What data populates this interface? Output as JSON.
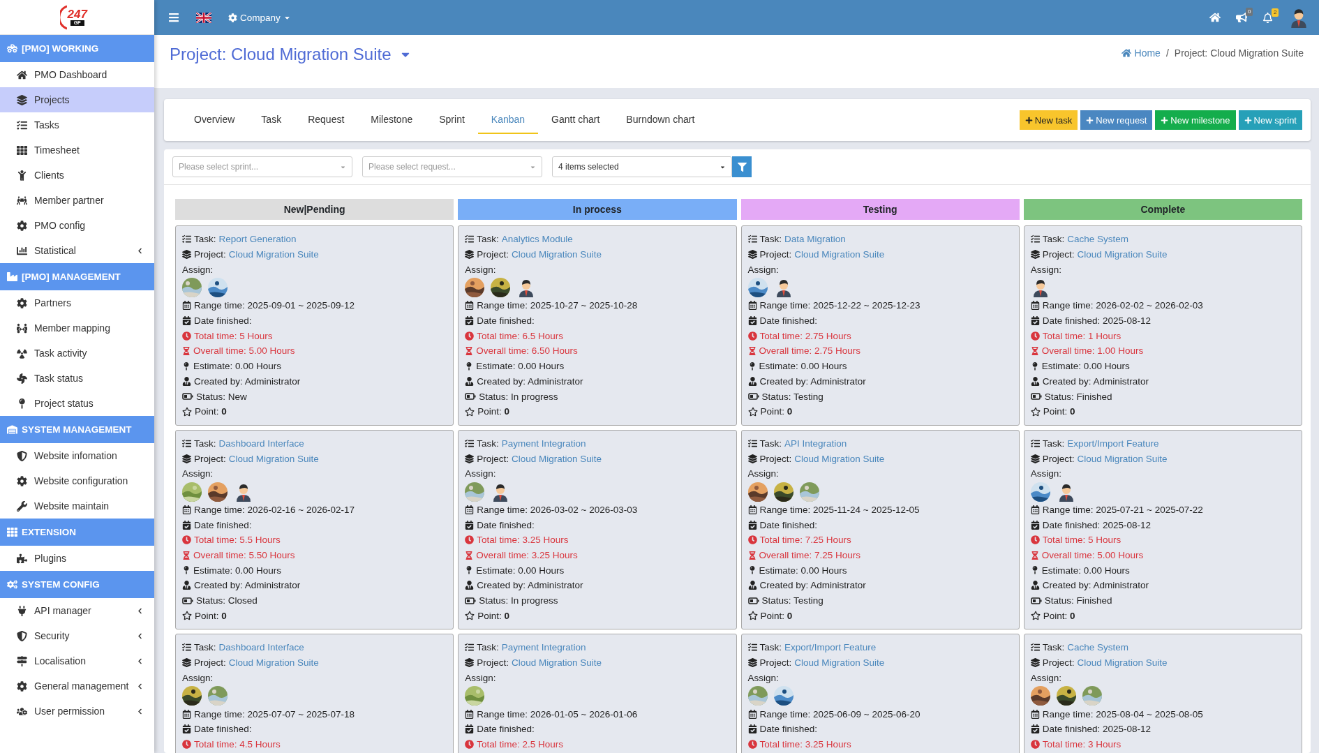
{
  "logo": {
    "text": "247",
    "sub": "GP"
  },
  "sidebar": {
    "sections": [
      {
        "title": "[PMO] WORKING",
        "items": [
          {
            "label": "PMO Dashboard",
            "selected": false
          },
          {
            "label": "Projects",
            "selected": true
          },
          {
            "label": "Tasks",
            "selected": false
          },
          {
            "label": "Timesheet",
            "selected": false
          },
          {
            "label": "Clients",
            "selected": false
          },
          {
            "label": "Member partner",
            "selected": false
          },
          {
            "label": "PMO config",
            "selected": false
          },
          {
            "label": "Statistical",
            "selected": false,
            "expanded": false
          }
        ]
      },
      {
        "title": "[PMO] MANAGEMENT",
        "items": [
          {
            "label": "Partners",
            "selected": false
          },
          {
            "label": "Member mapping",
            "selected": false
          },
          {
            "label": "Task activity",
            "selected": false
          },
          {
            "label": "Task status",
            "selected": false
          },
          {
            "label": "Project status",
            "selected": false
          }
        ]
      },
      {
        "title": "SYSTEM MANAGEMENT",
        "items": [
          {
            "label": "Website infomation",
            "selected": false
          },
          {
            "label": "Website configuration",
            "selected": false
          },
          {
            "label": "Website maintain",
            "selected": false
          }
        ]
      },
      {
        "title": "EXTENSION",
        "items": [
          {
            "label": "Plugins",
            "selected": false
          }
        ]
      },
      {
        "title": "SYSTEM CONFIG",
        "items": [
          {
            "label": "API manager",
            "selected": false,
            "expanded": false
          },
          {
            "label": "Security",
            "selected": false,
            "expanded": false
          },
          {
            "label": "Localisation",
            "selected": false,
            "expanded": false
          },
          {
            "label": "General management",
            "selected": false,
            "expanded": false
          },
          {
            "label": "User permission",
            "selected": false,
            "expanded": false
          }
        ]
      }
    ]
  },
  "topbar": {
    "menu": "Company",
    "announcements": "0",
    "notifications": "2"
  },
  "page_title": "Project: Cloud Migration Suite",
  "breadcrumb": {
    "home": "Home",
    "separator": "/",
    "current": "Project: Cloud Migration Suite"
  },
  "tabs": [
    {
      "label": "Overview",
      "selected": false
    },
    {
      "label": "Task",
      "selected": false
    },
    {
      "label": "Request",
      "selected": false
    },
    {
      "label": "Milestone",
      "selected": false
    },
    {
      "label": "Sprint",
      "selected": false
    },
    {
      "label": "Kanban",
      "selected": true
    },
    {
      "label": "Gantt chart",
      "selected": false
    },
    {
      "label": "Burndown chart",
      "selected": false
    }
  ],
  "actions": [
    {
      "label": "New task",
      "color": "#f8c52c"
    },
    {
      "label": "New request",
      "color": "#4a87c1"
    },
    {
      "label": "New milestone",
      "color": "#14ad4c"
    },
    {
      "label": "New sprint",
      "color": "#26a0b8"
    }
  ],
  "filters": [
    {
      "placeholder": "Please select sprint..."
    },
    {
      "placeholder": "Please select request..."
    },
    {
      "value": "4 items selected"
    }
  ],
  "columns": [
    {
      "title": "New|Pending",
      "color": "#dddddd",
      "cards": [
        {
          "task_label": "Task:",
          "task": "Report Generation",
          "project_label": "Project:",
          "project": "Cloud Migration Suite",
          "assign_label": "Assign:",
          "assign": [
            {
              "kind": "picture"
            },
            {
              "kind": "picture"
            }
          ],
          "range": "Range time: 2025-09-01 ~ 2025-09-12",
          "finished": "Date finished:",
          "total": "Total time: 5 Hours",
          "overall": "Overall time: 5.00 Hours",
          "estimate": "Estimate: 0.00 Hours",
          "created": "Created by: Administrator",
          "status": "Status: New",
          "point_label": "Point:",
          "point": "0"
        },
        {
          "task_label": "Task:",
          "task": "Dashboard Interface",
          "project_label": "Project:",
          "project": "Cloud Migration Suite",
          "assign_label": "Assign:",
          "assign": [
            {
              "kind": "picture"
            },
            {
              "kind": "picture"
            },
            {
              "kind": "person"
            }
          ],
          "range": "Range time: 2026-02-16 ~ 2026-02-17",
          "finished": "Date finished:",
          "total": "Total time: 5.5 Hours",
          "overall": "Overall time: 5.50 Hours",
          "estimate": "Estimate: 0.00 Hours",
          "created": "Created by: Administrator",
          "status": "Status: Closed",
          "point_label": "Point:",
          "point": "0"
        },
        {
          "task_label": "Task:",
          "task": "Dashboard Interface",
          "project_label": "Project:",
          "project": "Cloud Migration Suite",
          "assign_label": "Assign:",
          "assign": [
            {
              "kind": "picture"
            },
            {
              "kind": "picture"
            }
          ],
          "range": "Range time: 2025-07-07 ~ 2025-07-18",
          "finished": "Date finished:",
          "total": "Total time: 4.5 Hours"
        }
      ]
    },
    {
      "title": "In process",
      "color": "#79aef7",
      "cards": [
        {
          "task_label": "Task:",
          "task": "Analytics Module",
          "project_label": "Project:",
          "project": "Cloud Migration Suite",
          "assign_label": "Assign:",
          "assign": [
            {
              "kind": "picture"
            },
            {
              "kind": "picture"
            },
            {
              "kind": "person"
            }
          ],
          "range": "Range time: 2025-10-27 ~ 2025-10-28",
          "finished": "Date finished:",
          "total": "Total time: 6.5 Hours",
          "overall": "Overall time: 6.50 Hours",
          "estimate": "Estimate: 0.00 Hours",
          "created": "Created by: Administrator",
          "status": "Status: In progress",
          "point_label": "Point:",
          "point": "0"
        },
        {
          "task_label": "Task:",
          "task": "Payment Integration",
          "project_label": "Project:",
          "project": "Cloud Migration Suite",
          "assign_label": "Assign:",
          "assign": [
            {
              "kind": "picture"
            },
            {
              "kind": "person"
            }
          ],
          "range": "Range time: 2026-03-02 ~ 2026-03-03",
          "finished": "Date finished:",
          "total": "Total time: 3.25 Hours",
          "overall": "Overall time: 3.25 Hours",
          "estimate": "Estimate: 0.00 Hours",
          "created": "Created by: Administrator",
          "status": "Status: In progress",
          "point_label": "Point:",
          "point": "0"
        },
        {
          "task_label": "Task:",
          "task": "Payment Integration",
          "project_label": "Project:",
          "project": "Cloud Migration Suite",
          "assign_label": "Assign:",
          "assign": [
            {
              "kind": "picture"
            }
          ],
          "range": "Range time: 2026-01-05 ~ 2026-01-06",
          "finished": "Date finished:",
          "total": "Total time: 2.5 Hours"
        }
      ]
    },
    {
      "title": "Testing",
      "color": "#e4a9f6",
      "cards": [
        {
          "task_label": "Task:",
          "task": "Data Migration",
          "project_label": "Project:",
          "project": "Cloud Migration Suite",
          "assign_label": "Assign:",
          "assign": [
            {
              "kind": "picture"
            },
            {
              "kind": "person"
            }
          ],
          "range": "Range time: 2025-12-22 ~ 2025-12-23",
          "finished": "Date finished:",
          "total": "Total time: 2.75 Hours",
          "overall": "Overall time: 2.75 Hours",
          "estimate": "Estimate: 0.00 Hours",
          "created": "Created by: Administrator",
          "status": "Status: Testing",
          "point_label": "Point:",
          "point": "0"
        },
        {
          "task_label": "Task:",
          "task": "API Integration",
          "project_label": "Project:",
          "project": "Cloud Migration Suite",
          "assign_label": "Assign:",
          "assign": [
            {
              "kind": "picture"
            },
            {
              "kind": "picture"
            },
            {
              "kind": "picture"
            }
          ],
          "range": "Range time: 2025-11-24 ~ 2025-12-05",
          "finished": "Date finished:",
          "total": "Total time: 7.25 Hours",
          "overall": "Overall time: 7.25 Hours",
          "estimate": "Estimate: 0.00 Hours",
          "created": "Created by: Administrator",
          "status": "Status: Testing",
          "point_label": "Point:",
          "point": "0"
        },
        {
          "task_label": "Task:",
          "task": "Export/Import Feature",
          "project_label": "Project:",
          "project": "Cloud Migration Suite",
          "assign_label": "Assign:",
          "assign": [
            {
              "kind": "picture"
            },
            {
              "kind": "picture"
            }
          ],
          "range": "Range time: 2025-06-09 ~ 2025-06-20",
          "finished": "Date finished:",
          "total": "Total time: 3.25 Hours"
        }
      ]
    },
    {
      "title": "Complete",
      "color": "#7dc47f",
      "cards": [
        {
          "task_label": "Task:",
          "task": "Cache System",
          "project_label": "Project:",
          "project": "Cloud Migration Suite",
          "assign_label": "Assign:",
          "assign": [
            {
              "kind": "person"
            }
          ],
          "range": "Range time: 2026-02-02 ~ 2026-02-03",
          "finished": "Date finished: 2025-08-12",
          "total": "Total time: 1 Hours",
          "overall": "Overall time: 1.00 Hours",
          "estimate": "Estimate: 0.00 Hours",
          "created": "Created by: Administrator",
          "status": "Status: Finished",
          "point_label": "Point:",
          "point": "0"
        },
        {
          "task_label": "Task:",
          "task": "Export/Import Feature",
          "project_label": "Project:",
          "project": "Cloud Migration Suite",
          "assign_label": "Assign:",
          "assign": [
            {
              "kind": "picture"
            },
            {
              "kind": "person"
            }
          ],
          "range": "Range time: 2025-07-21 ~ 2025-07-22",
          "finished": "Date finished: 2025-08-12",
          "total": "Total time: 5 Hours",
          "overall": "Overall time: 5.00 Hours",
          "estimate": "Estimate: 0.00 Hours",
          "created": "Created by: Administrator",
          "status": "Status: Finished",
          "point_label": "Point:",
          "point": "0"
        },
        {
          "task_label": "Task:",
          "task": "Cache System",
          "project_label": "Project:",
          "project": "Cloud Migration Suite",
          "assign_label": "Assign:",
          "assign": [
            {
              "kind": "picture"
            },
            {
              "kind": "picture"
            },
            {
              "kind": "picture"
            }
          ],
          "range": "Range time: 2025-08-04 ~ 2025-08-05",
          "finished": "Date finished: 2025-08-12",
          "total": "Total time: 3 Hours"
        }
      ]
    }
  ]
}
